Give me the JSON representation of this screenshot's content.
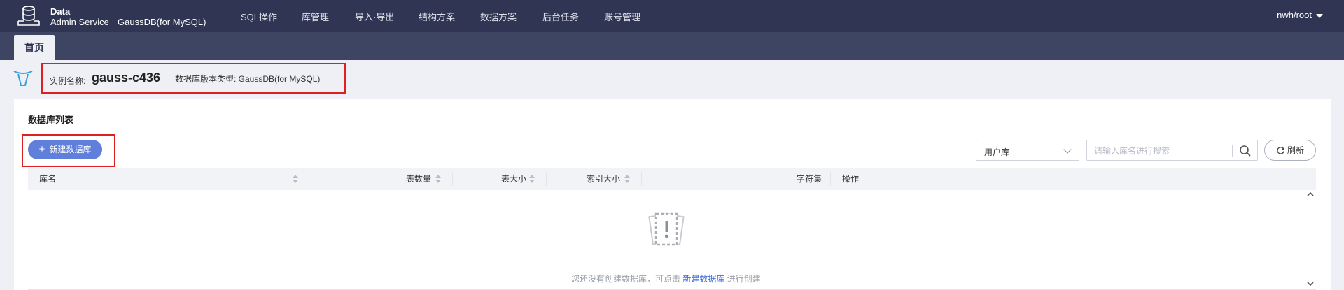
{
  "header": {
    "brand_line1": "Data",
    "brand_line2": "Admin Service",
    "engine": "GaussDB(for MySQL)",
    "nav": [
      {
        "label": "SQL操作"
      },
      {
        "label": "库管理"
      },
      {
        "label": "导入·导出"
      },
      {
        "label": "结构方案"
      },
      {
        "label": "数据方案"
      },
      {
        "label": "后台任务"
      },
      {
        "label": "账号管理"
      }
    ],
    "user": "nwh/root"
  },
  "tabs": [
    {
      "label": "首页"
    }
  ],
  "instance": {
    "name_label": "实例名称:",
    "name": "gauss-c436",
    "type_label": "数据库版本类型:",
    "type_value": "GaussDB(for MySQL)",
    "type_text": "数据库版本类型: GaussDB(for MySQL)"
  },
  "db_list": {
    "title": "数据库列表",
    "create_button": "新建数据库",
    "filter_selected": "用户库",
    "search_placeholder": "请输入库名进行搜索",
    "refresh_button": "刷新",
    "columns": [
      {
        "label": "库名",
        "sortable": true
      },
      {
        "label": "表数量",
        "sortable": true
      },
      {
        "label": "表大小",
        "sortable": true
      },
      {
        "label": "索引大小",
        "sortable": true
      },
      {
        "label": "字符集",
        "sortable": false
      },
      {
        "label": "操作",
        "sortable": false
      }
    ],
    "rows": [],
    "empty": {
      "text_before": "您还没有创建数据库，可点击 ",
      "link": "新建数据库",
      "text_after": " 进行创建"
    }
  },
  "colors": {
    "topbar": "#2f3553",
    "accent": "#5f7fdb",
    "highlight_box": "#e02020",
    "link": "#3e6cd8"
  }
}
